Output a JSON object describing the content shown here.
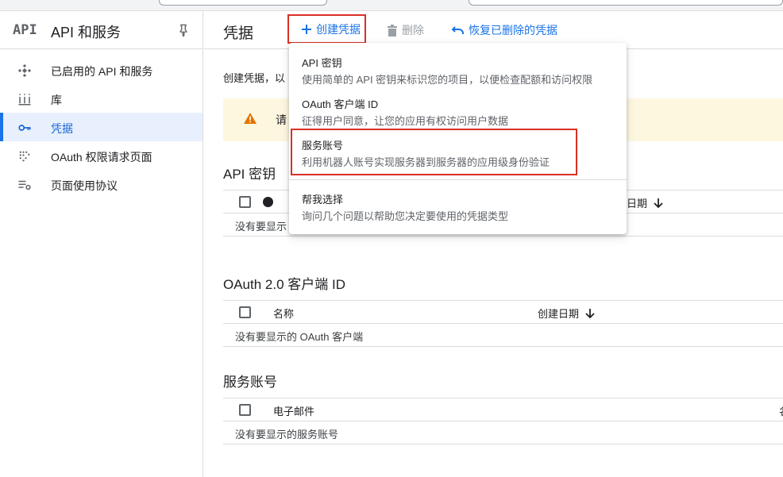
{
  "sidebar": {
    "logo": "API",
    "title": "API 和服务",
    "items": [
      {
        "label": "已启用的 API 和服务",
        "icon": "api-diamond-icon"
      },
      {
        "label": "库",
        "icon": "library-icon"
      },
      {
        "label": "凭据",
        "icon": "key-icon",
        "active": true
      },
      {
        "label": "OAuth 权限请求页面",
        "icon": "oauth-dots-icon"
      },
      {
        "label": "页面使用协议",
        "icon": "settings-list-icon"
      }
    ]
  },
  "header": {
    "title": "凭据",
    "create_label": "创建凭据",
    "delete_label": "删除",
    "restore_label": "恢复已删除的凭据"
  },
  "main": {
    "description": "创建凭据，以",
    "warning_text": "请"
  },
  "sections": {
    "api_keys": {
      "title": "API 密钥",
      "created_col": "日期",
      "empty": "没有要显示"
    },
    "oauth": {
      "title": "OAuth 2.0 客户端 ID",
      "name_col": "名称",
      "created_col": "创建日期",
      "empty": "没有要显示的 OAuth 客户端"
    },
    "service_accounts": {
      "title": "服务账号",
      "email_col": "电子邮件",
      "cut_col": "名",
      "empty": "没有要显示的服务账号"
    }
  },
  "menu": {
    "items": [
      {
        "title": "API 密钥",
        "desc": "使用简单的 API 密钥来标识您的项目，以便检查配额和访问权限"
      },
      {
        "title": "OAuth 客户端 ID",
        "desc": "征得用户同意，让您的应用有权访问用户数据"
      },
      {
        "title": "服务账号",
        "desc": "利用机器人账号实现服务器到服务器的应用级身份验证",
        "highlighted": true
      },
      {
        "title": "帮我选择",
        "desc": "询问几个问题以帮助您决定要使用的凭据类型"
      }
    ]
  },
  "colors": {
    "accent": "#1a73e8",
    "highlight": "#d93025",
    "warning_bg": "#fef7e0",
    "warning_icon": "#e37400"
  }
}
